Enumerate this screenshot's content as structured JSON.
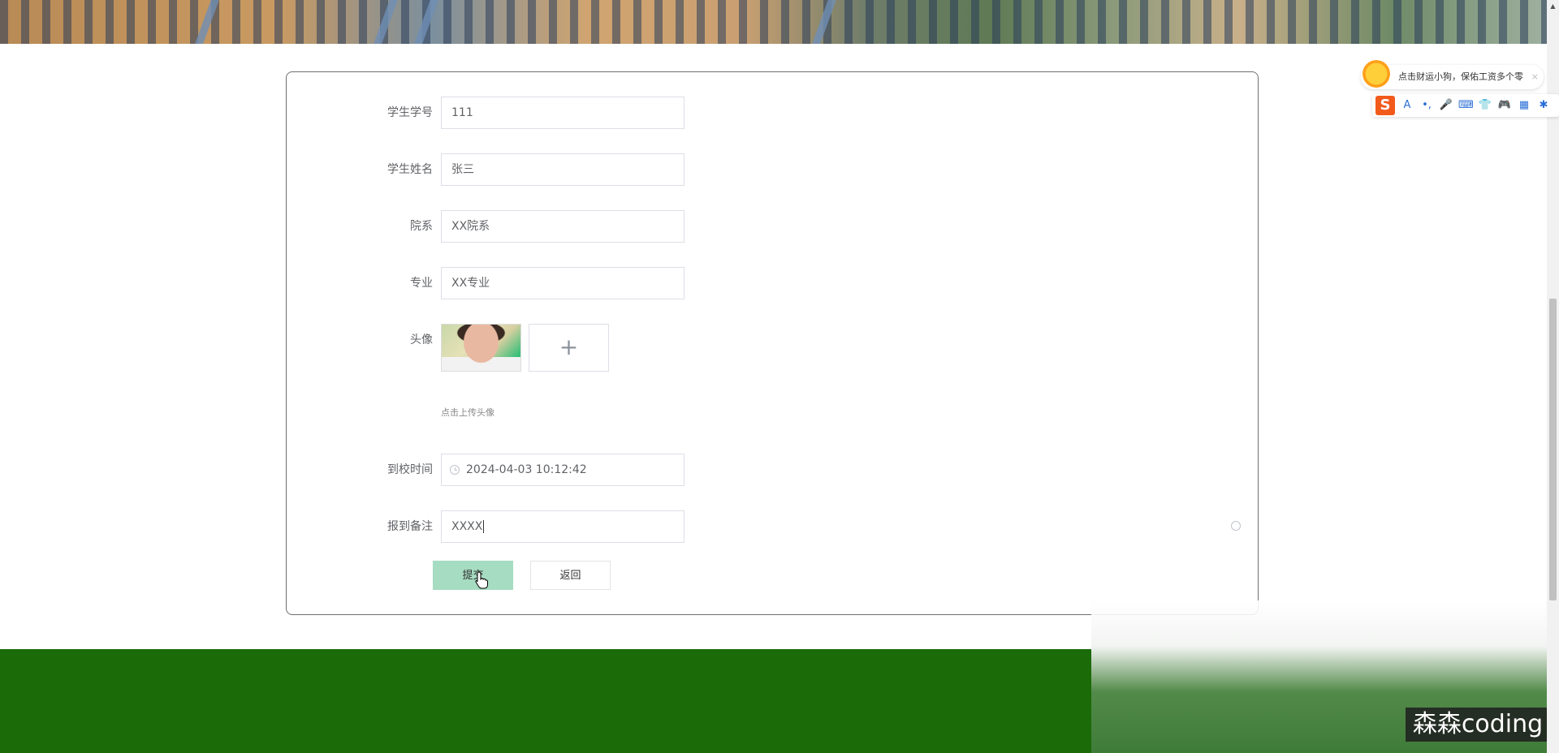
{
  "form": {
    "fields": [
      {
        "label": "学生学号",
        "value": "111"
      },
      {
        "label": "学生姓名",
        "value": "张三"
      },
      {
        "label": "院系",
        "value": "XX院系"
      },
      {
        "label": "专业",
        "value": "XX专业"
      }
    ],
    "avatar": {
      "label": "头像",
      "upload_symbol": "+",
      "hint": "点击上传头像"
    },
    "arrival": {
      "label": "到校时间",
      "value": "2024-04-03 10:12:42"
    },
    "note": {
      "label": "报到备注",
      "value": "XXXX"
    },
    "buttons": {
      "submit": "提交",
      "back": "返回"
    }
  },
  "ime": {
    "tip_text": "点击财运小狗，保佑工资多个零",
    "close": "×",
    "logo": "S",
    "tools": [
      "A",
      "•,",
      "🎤",
      "⌨",
      "👕",
      "🎮",
      "▦",
      "✱"
    ]
  },
  "watermark": "森森coding",
  "colors": {
    "submit_bg": "#a6dcc1",
    "footer_green": "#1b6b09",
    "ime_brand": "#f25a1c"
  },
  "icons": [
    "clock-icon",
    "clear-icon",
    "plus-icon",
    "scroll-up-icon",
    "sun-mascot-icon",
    "close-icon",
    "mouse-cursor-icon"
  ]
}
